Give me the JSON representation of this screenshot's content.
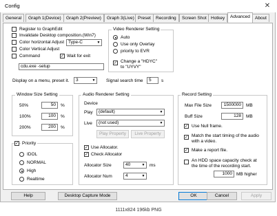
{
  "window": {
    "title": "Config",
    "close_glyph": "✕"
  },
  "tabs": [
    "General",
    "Graph 1(Device)",
    "Graph 2(Preview)",
    "Graph 3(Live)",
    "Preset",
    "Recording",
    "Screen Shot",
    "Hotkey",
    "Advanced",
    "About"
  ],
  "active_tab": "Advanced",
  "top_options": {
    "register": "Register to GraphEdit",
    "invalidate": "Invalidate Desktop composition.(Win7)",
    "color_horizontal": "Color horizontal Adjust",
    "color_type_value": "Type-C",
    "color_vertical": "Color Vertical Adjust",
    "command": "Command",
    "wait_for_exit": "Wait for exit",
    "wait_checked_glyph": "✓",
    "command_value": "cdu.exe -setup"
  },
  "display_preset": {
    "label": "Display on a menu, preset it.",
    "value": "3"
  },
  "signal_search": {
    "label": "Signal search time",
    "value": "5",
    "unit": "s"
  },
  "video_renderer": {
    "title": "Video Renderer Setting",
    "options": [
      "Auto",
      "Use only Overlay",
      "priority to EVR"
    ],
    "selected": "Auto",
    "change_label_1": "Change a \"HDYC\"",
    "change_label_2": "to \"UYVY\"",
    "change_checked_glyph": "✓"
  },
  "window_size": {
    "title": "Window Size Setting",
    "rows": [
      {
        "label": "50%",
        "value": "50",
        "unit": "%"
      },
      {
        "label": "100%",
        "value": "100",
        "unit": "%"
      },
      {
        "label": "200%",
        "value": "200",
        "unit": "%"
      }
    ]
  },
  "priority": {
    "title": "Priority",
    "checked_glyph": "✓",
    "options": [
      "IDOL",
      "NORMAL",
      "High",
      "Realtime"
    ],
    "selected": "High"
  },
  "audio_renderer": {
    "title": "Audio Renderer Setting",
    "device_label": "Device",
    "play_label": "Play",
    "play_value": "(default)",
    "live_label": "Live",
    "live_value": "(not used)",
    "play_property": "Play Property",
    "live_property": "Live Property",
    "use_allocator": "Use Allocator.",
    "check_allocator": "Check Allocator",
    "checked_glyph": "✓",
    "allocator_size_label": "Allocator Size",
    "allocator_size_value": "40",
    "allocator_size_unit": "ms",
    "allocator_num_label": "Allocator Num",
    "allocator_num_value": "4"
  },
  "record": {
    "title": "Record Setting",
    "max_file_label": "Max File Size",
    "max_file_value": "1500000",
    "max_file_unit": "MB",
    "buff_label": "Buff Size",
    "buff_value": "128",
    "buff_unit": "MB",
    "checked_glyph": "✓",
    "use_null": "Use Null frame.",
    "match_1": "Match the start timing of the audio",
    "match_2": "with a video.",
    "make_report": "Make a report file.",
    "hdd_1": "An HDD space capacity check at",
    "hdd_2": "the time of the recording start.",
    "hdd_value": "1000",
    "hdd_unit": "MB higher"
  },
  "buttons": {
    "help": "Help",
    "desktop_capture": "Desktop Capture Mode",
    "ok": "OK",
    "cancel": "Cancel",
    "apply": "Apply"
  },
  "combo_arrow": "▼",
  "footer_text": "1111x824 196kb PNG"
}
